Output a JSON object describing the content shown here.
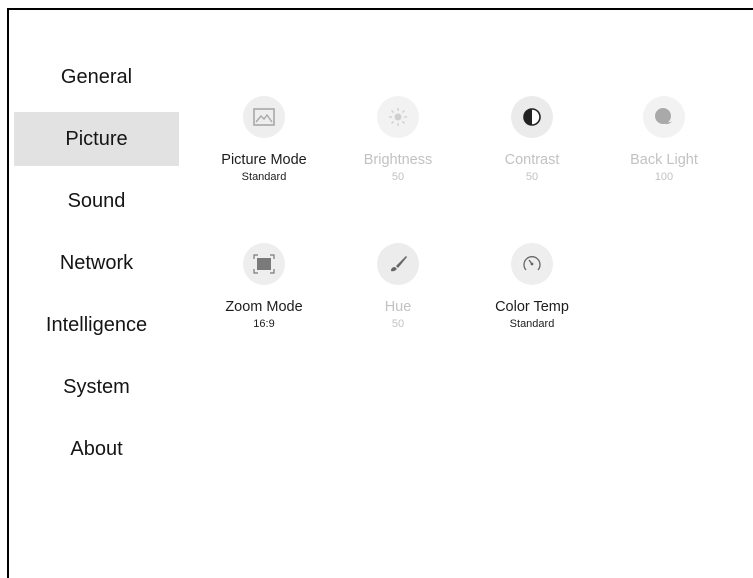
{
  "sidebar": {
    "items": [
      {
        "label": "General"
      },
      {
        "label": "Picture",
        "selected": true
      },
      {
        "label": "Sound"
      },
      {
        "label": "Network"
      },
      {
        "label": "Intelligence"
      },
      {
        "label": "System"
      },
      {
        "label": "About"
      }
    ]
  },
  "settings": {
    "picture_mode": {
      "label": "Picture Mode",
      "value": "Standard",
      "icon": "image-icon",
      "enabled": true
    },
    "brightness": {
      "label": "Brightness",
      "value": "50",
      "icon": "sun-icon",
      "enabled": false
    },
    "contrast": {
      "label": "Contrast",
      "value": "50",
      "icon": "contrast-icon",
      "enabled": false
    },
    "back_light": {
      "label": "Back Light",
      "value": "100",
      "icon": "backlight-icon",
      "enabled": false
    },
    "zoom_mode": {
      "label": "Zoom Mode",
      "value": "16:9",
      "icon": "zoom-frame-icon",
      "enabled": true
    },
    "hue": {
      "label": "Hue",
      "value": "50",
      "icon": "brush-icon",
      "enabled": false
    },
    "color_temp": {
      "label": "Color Temp",
      "value": "Standard",
      "icon": "gauge-icon",
      "enabled": true
    }
  },
  "colors": {
    "selected_bg": "#e2e2e2",
    "enabled_text": "#1d1d1d",
    "disabled_text": "#c2c2c2",
    "icon_circle": "#eeeeee"
  }
}
